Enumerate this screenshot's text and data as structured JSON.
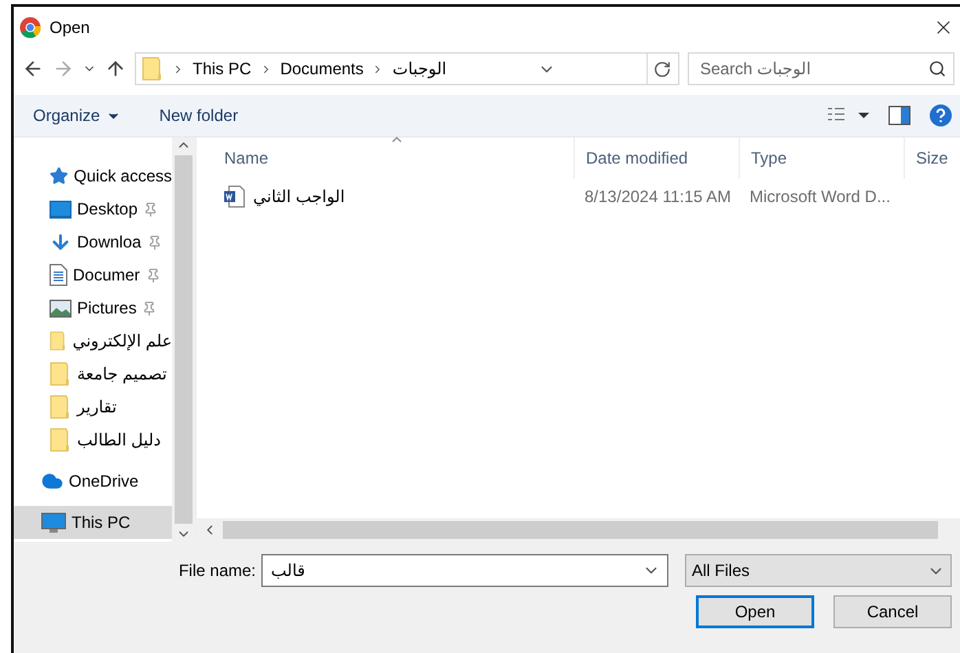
{
  "window": {
    "title": "Open"
  },
  "address": {
    "segments": [
      "This PC",
      "Documents",
      "الوجبات"
    ]
  },
  "search": {
    "placeholder": "Search الوجبات"
  },
  "toolbar": {
    "organize": "Organize",
    "new_folder": "New folder"
  },
  "nav": [
    {
      "kind": "star",
      "label": "Quick access",
      "pinned": false,
      "selected": false
    },
    {
      "kind": "desktop",
      "label": "Desktop",
      "pinned": true,
      "selected": false
    },
    {
      "kind": "download",
      "label": "Downloa",
      "pinned": true,
      "selected": false
    },
    {
      "kind": "document",
      "label": "Documer",
      "pinned": true,
      "selected": false
    },
    {
      "kind": "pictures",
      "label": "Pictures",
      "pinned": true,
      "selected": false
    },
    {
      "kind": "folder",
      "label": "علم الإلكتروني",
      "pinned": false,
      "selected": false
    },
    {
      "kind": "folder",
      "label": "تصميم جامعة",
      "pinned": false,
      "selected": false
    },
    {
      "kind": "folder",
      "label": "تقارير",
      "pinned": false,
      "selected": false
    },
    {
      "kind": "folder",
      "label": "دليل الطالب",
      "pinned": false,
      "selected": false
    },
    {
      "kind": "cloud",
      "label": "OneDrive",
      "pinned": false,
      "selected": false
    },
    {
      "kind": "computer",
      "label": "This PC",
      "pinned": false,
      "selected": true
    }
  ],
  "table": {
    "columns": [
      "Name",
      "Date modified",
      "Type",
      "Size"
    ],
    "rows": [
      {
        "name": "الواجب الثاني",
        "date": "8/13/2024 11:15 AM",
        "type": "Microsoft Word D..."
      }
    ]
  },
  "file_name": {
    "label": "File name:",
    "value": "قالب"
  },
  "file_type": {
    "value": "All Files"
  },
  "buttons": [
    {
      "label": "Open",
      "default": true
    },
    {
      "label": "Cancel",
      "default": false
    }
  ]
}
